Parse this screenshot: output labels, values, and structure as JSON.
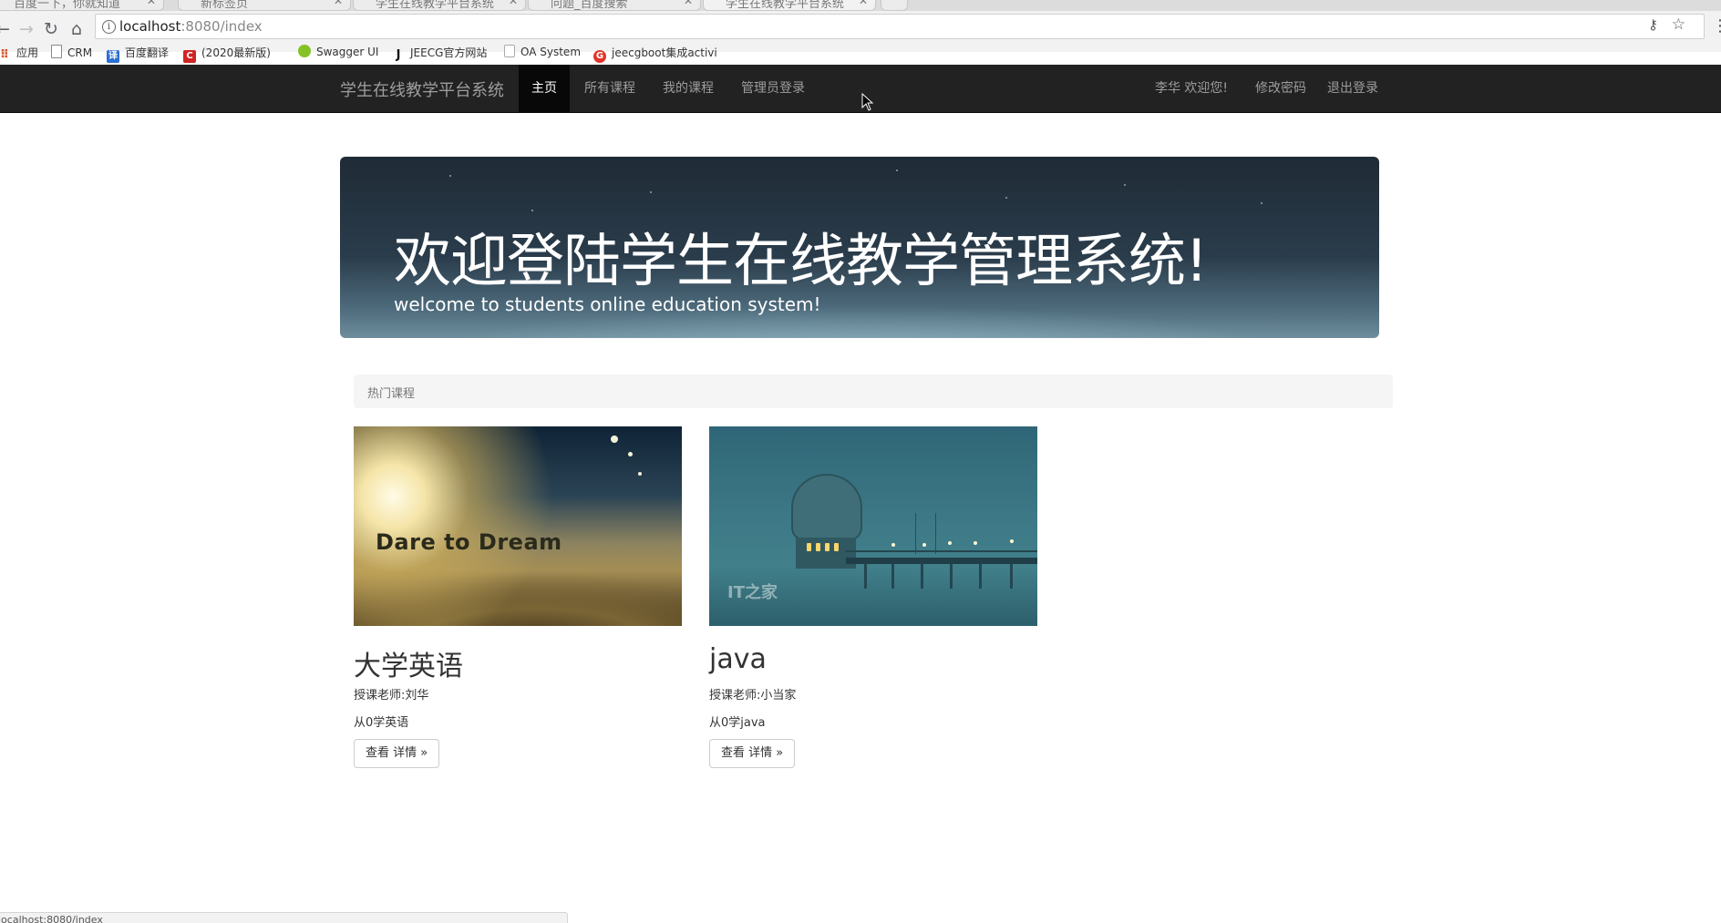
{
  "browser": {
    "tabs": [
      {
        "label": "百度一下，你就知道"
      },
      {
        "label": "新标签页"
      },
      {
        "label": "学生在线教学平台系统"
      },
      {
        "label": "问题_百度搜索"
      },
      {
        "label": "学生在线教学平台系统"
      }
    ],
    "url": {
      "host": "localhost",
      "path": ":8080/index"
    },
    "bookmarks": [
      {
        "label": "应用",
        "icon": "apps-icon"
      },
      {
        "label": "CRM",
        "icon": "page-icon"
      },
      {
        "label": "百度翻译",
        "icon": "baidu-translate-icon"
      },
      {
        "label": "(2020最新版)",
        "icon": "c-icon"
      },
      {
        "label": "Swagger UI",
        "icon": "swagger-icon"
      },
      {
        "label": "JEECG官方网站",
        "icon": "j-icon"
      },
      {
        "label": "OA System",
        "icon": "page-icon"
      },
      {
        "label": "jeecgboot集成activi",
        "icon": "g-icon"
      }
    ],
    "status_text": "localhost:8080/index"
  },
  "navbar": {
    "brand": "学生在线教学平台系统",
    "items": [
      {
        "label": "主页",
        "active": true
      },
      {
        "label": "所有课程",
        "active": false
      },
      {
        "label": "我的课程",
        "active": false
      },
      {
        "label": "管理员登录",
        "active": false
      }
    ],
    "right_items": [
      {
        "label": "李华 欢迎您!"
      },
      {
        "label": "修改密码"
      },
      {
        "label": "退出登录"
      }
    ]
  },
  "jumbotron": {
    "title": "欢迎登陆学生在线教学管理系统!",
    "subtitle": "welcome to students online education system!"
  },
  "hot_courses": {
    "heading": "热门课程",
    "courses": [
      {
        "image_text": "Dare to Dream",
        "title": "大学英语",
        "teacher": "授课老师:刘华",
        "description": "从0学英语",
        "button": "查看 详情 »"
      },
      {
        "image_text": "IT之家",
        "title": "java",
        "teacher": "授课老师:小当家",
        "description": "从0学java",
        "button": "查看 详情 »"
      }
    ]
  },
  "colors": {
    "navbar_bg": "#222222",
    "navbar_active_bg": "#080808",
    "navbar_text": "#9d9d9d",
    "section_head_bg": "#f5f5f5"
  }
}
